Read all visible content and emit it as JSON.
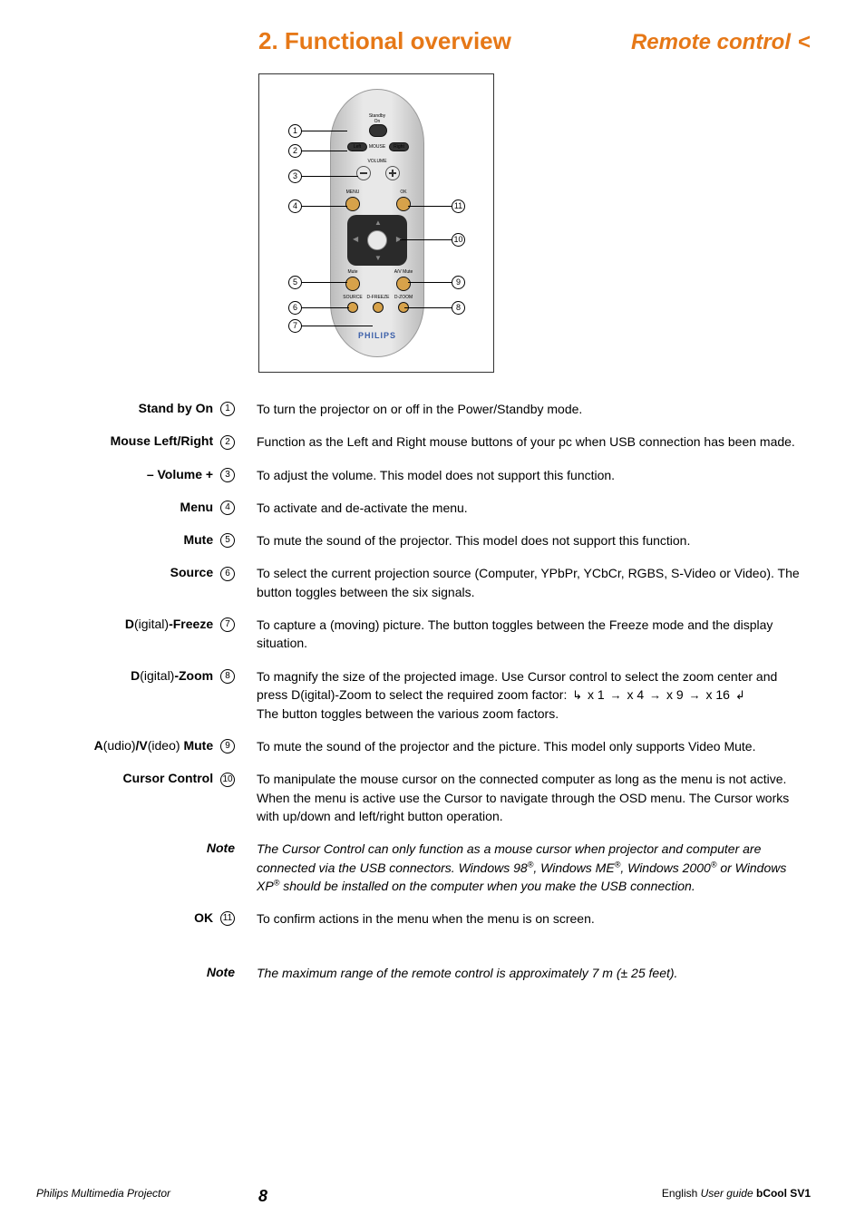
{
  "header": {
    "section_title": "2. Functional overview",
    "subtitle": "Remote control",
    "chevron": "<"
  },
  "remote": {
    "labels": {
      "standby": "Standby\nOn",
      "mouse": "MOUSE",
      "left": "Left",
      "right": "Right",
      "volume": "VOLUME",
      "menu": "MENU",
      "ok": "OK",
      "mute": "Mute",
      "av_mute": "A/V Mute",
      "source": "SOURCE",
      "dfreeze": "D-FREEZE",
      "dzoom": "D-ZOOM"
    },
    "brand": "PHILIPS",
    "callouts_left": [
      "1",
      "2",
      "3",
      "4",
      "5",
      "6",
      "7"
    ],
    "callouts_right": [
      "11",
      "10",
      "9",
      "8"
    ]
  },
  "definitions": [
    {
      "label_parts": [
        {
          "t": "Stand by On",
          "b": true
        }
      ],
      "num": "1",
      "desc": "To turn the projector on or off in the Power/Standby mode."
    },
    {
      "label_parts": [
        {
          "t": "Mouse Left/Right",
          "b": true
        }
      ],
      "num": "2",
      "desc": "Function as the Left and Right mouse buttons of your pc when USB connection has been made."
    },
    {
      "label_parts": [
        {
          "t": "– Volume +",
          "b": true
        }
      ],
      "num": "3",
      "desc": "To adjust the volume. This model does not support this function."
    },
    {
      "label_parts": [
        {
          "t": "Menu",
          "b": true
        }
      ],
      "num": "4",
      "desc": "To activate and de-activate the menu."
    },
    {
      "label_parts": [
        {
          "t": "Mute",
          "b": true
        }
      ],
      "num": "5",
      "desc": "To mute the sound of the projector. This model does not support this function."
    },
    {
      "label_parts": [
        {
          "t": "Source",
          "b": true
        }
      ],
      "num": "6",
      "desc": "To select the current projection source (Computer, YPbPr, YCbCr, RGBS, S-Video or Video). The button toggles between the six signals."
    },
    {
      "label_parts": [
        {
          "t": "D",
          "b": true
        },
        {
          "t": "(igital)",
          "b": false
        },
        {
          "t": "-Freeze",
          "b": true
        }
      ],
      "num": "7",
      "desc": "To capture a (moving) picture. The button toggles between the Freeze mode and the display situation."
    },
    {
      "label_parts": [
        {
          "t": "D",
          "b": true
        },
        {
          "t": "(igital)",
          "b": false
        },
        {
          "t": "-Zoom",
          "b": true
        }
      ],
      "num": "8",
      "desc_prefix": "To magnify the size of the projected image. Use Cursor control to select the zoom center and press D(igital)-Zoom to select the required zoom factor:  ",
      "zoom_seq": [
        "x 1",
        "x 4",
        "x 9",
        "x 16"
      ],
      "desc_suffix": "The button toggles between the various zoom factors."
    },
    {
      "label_parts": [
        {
          "t": "A",
          "b": true
        },
        {
          "t": "(udio)",
          "b": false
        },
        {
          "t": "/V",
          "b": true
        },
        {
          "t": "(ideo) ",
          "b": false
        },
        {
          "t": "Mute",
          "b": true
        }
      ],
      "num": "9",
      "desc": "To mute the sound of the projector and the picture. This model only supports Video Mute."
    },
    {
      "label_parts": [
        {
          "t": "Cursor Control",
          "b": true
        }
      ],
      "num": "10",
      "desc": "To manipulate the mouse cursor on the connected computer as long as the menu is not active. When the menu is active use the Cursor to navigate through the OSD menu. The Cursor works with up/down and left/right button operation."
    },
    {
      "is_note": true,
      "label_parts": [
        {
          "t": "Note",
          "b": true,
          "i": true
        }
      ],
      "note_html": "The Cursor Control can only function as a mouse cursor when projector and computer are connected via the USB connectors. Windows 98<sup>®</sup>, Windows ME<sup>®</sup>, Windows 2000<sup>®</sup> or Windows XP<sup>®</sup> should be installed on the computer when you make the USB connection."
    },
    {
      "label_parts": [
        {
          "t": "OK",
          "b": true
        }
      ],
      "num": "11",
      "desc": "To confirm actions in the menu when the menu is on screen."
    }
  ],
  "bottom_note": {
    "label": "Note",
    "text": "The maximum range of the remote control is approximately 7 m (± 25 feet)."
  },
  "footer": {
    "left": "Philips Multimedia Projector",
    "page": "8",
    "right_lang": "English",
    "right_ug": " User guide  ",
    "right_product": "bCool SV1"
  }
}
